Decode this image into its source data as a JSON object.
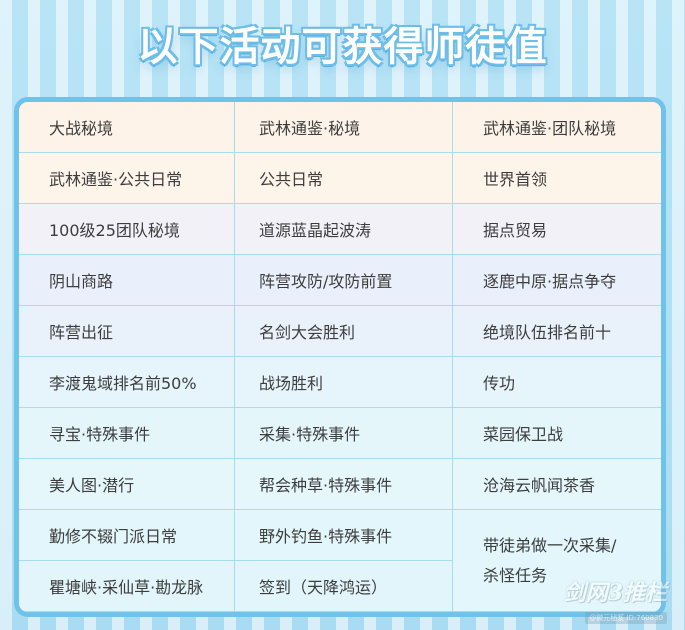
{
  "title": "以下活动可获得师徒值",
  "rows": [
    [
      "大战秘境",
      "武林通鉴·秘境",
      "武林通鉴·团队秘境"
    ],
    [
      "武林通鉴·公共日常",
      "公共日常",
      "世界首领"
    ],
    [
      "100级25团队秘境",
      "道源蓝晶起波涛",
      "据点贸易"
    ],
    [
      "阴山商路",
      "阵营攻防/攻防前置",
      "逐鹿中原·据点争夺"
    ],
    [
      "阵营出征",
      "名剑大会胜利",
      "绝境队伍排名前十"
    ],
    [
      "李渡鬼域排名前50%",
      "战场胜利",
      "传功"
    ],
    [
      "寻宝·特殊事件",
      "采集·特殊事件",
      "菜园保卫战"
    ],
    [
      "美人图·潜行",
      "帮会种草·特殊事件",
      "沧海云帆闻茶香"
    ],
    [
      "勤修不辍门派日常",
      "野外钓鱼·特殊事件",
      "带徒弟做一次采集/杀怪任务"
    ],
    [
      "瞿塘峡·采仙草·勘龙脉",
      "签到（天降鸿运）",
      null
    ]
  ],
  "watermark": {
    "main": "剑网3推栏",
    "sub": "@微元秘笈 ID:760830"
  },
  "colors": {
    "background": "#bfe7f7",
    "frame_border": "#6fc3ea",
    "grid_line": "#a7dbee",
    "text": "#3d3d3d"
  }
}
